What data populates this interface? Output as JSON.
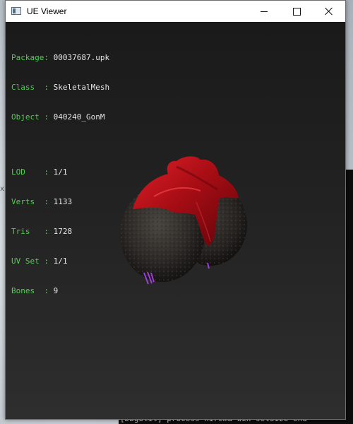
{
  "window": {
    "title": "UE Viewer"
  },
  "titlebar_buttons": {
    "minimize": "–",
    "maximize": "☐",
    "close": "✕"
  },
  "info": {
    "package": {
      "label": "Package:",
      "value": "00037687.upk"
    },
    "class": {
      "label": "Class  :",
      "value": "SkeletalMesh"
    },
    "object": {
      "label": "Object :",
      "value": "040240_GonM"
    },
    "lod": {
      "label": "LOD    :",
      "value": "1/1"
    },
    "verts": {
      "label": "Verts  :",
      "value": "1133"
    },
    "tris": {
      "label": "Tris   :",
      "value": "1728"
    },
    "uvset": {
      "label": "UV Set :",
      "value": "1/1"
    },
    "bones": {
      "label": "Bones  :",
      "value": "9"
    }
  },
  "background_console": {
    "bottom_line": "[DbgUtil] process  hirema win setSize  end"
  },
  "colors": {
    "label_green": "#4fd04f",
    "value_white": "#e8e8e8",
    "mesh_red": "#b00d14",
    "mesh_fur": "#2e2b28",
    "bone_purple": "#9b3fd6"
  }
}
